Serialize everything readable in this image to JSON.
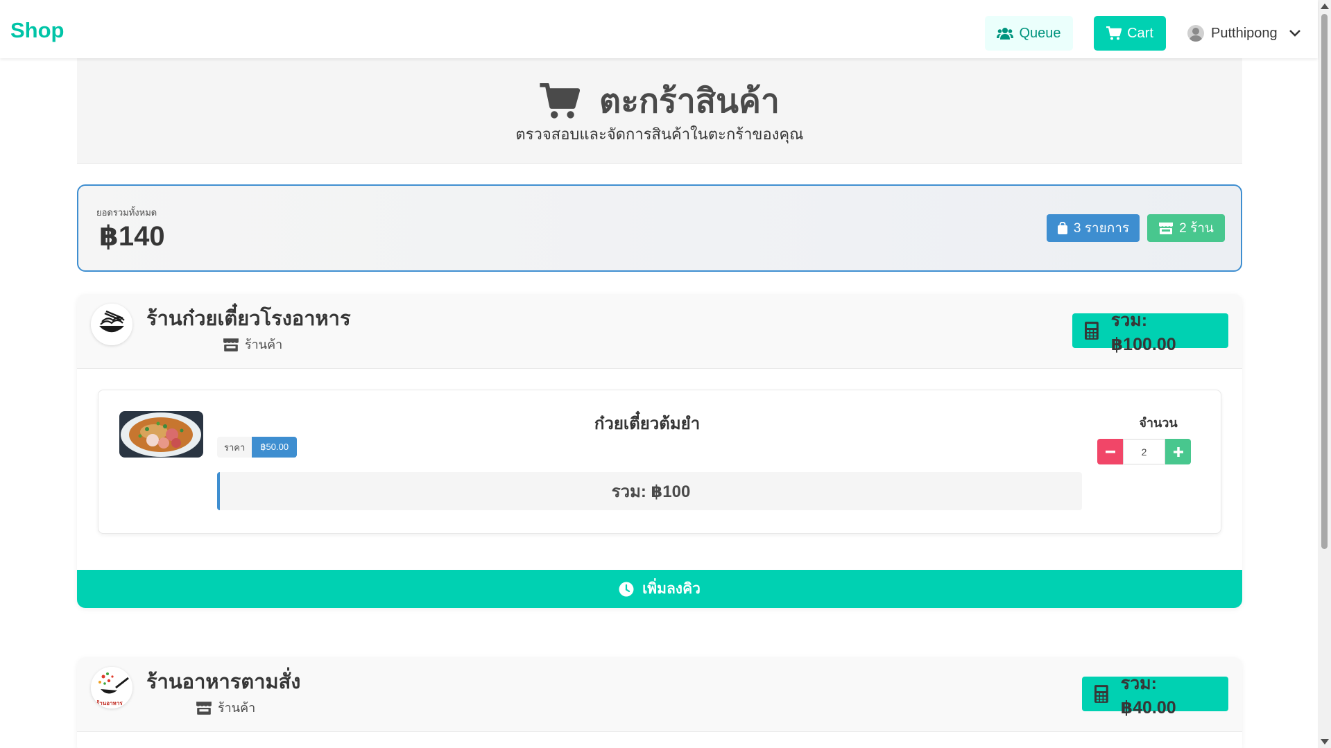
{
  "navbar": {
    "brand": "Shop",
    "queue_label": "Queue",
    "cart_label": "Cart",
    "user_name": "Putthipong"
  },
  "hero": {
    "title": "ตะกร้าสินค้า",
    "subtitle": "ตรวจสอบและจัดการสินค้าในตะกร้าของคุณ"
  },
  "summary": {
    "label": "ยอดรวมทั้งหมด",
    "total": "฿140",
    "items_tag": "3 รายการ",
    "shops_tag": "2 ร้าน"
  },
  "shops": [
    {
      "name": "ร้านก๋วยเตี๋ยวโรงอาหาร",
      "type_label": "ร้านค้า",
      "total": "รวม: ฿100.00",
      "items": [
        {
          "name": "ก๋วยเตี๋ยวต้มยำ",
          "price_label": "ราคา",
          "price": "฿50.00",
          "line_total": "รวม: ฿100",
          "qty_label": "จำนวน",
          "qty": "2"
        }
      ],
      "queue_button": "เพิ่มลงคิว"
    },
    {
      "name": "ร้านอาหารตามสั่ง",
      "type_label": "ร้านค้า",
      "total": "รวม: ฿40.00",
      "logo_text": "ร้านอาหาร"
    }
  ],
  "colors": {
    "primary": "#00d1b2",
    "info": "#3e8ed0",
    "success": "#48c78e",
    "danger": "#f14668"
  }
}
